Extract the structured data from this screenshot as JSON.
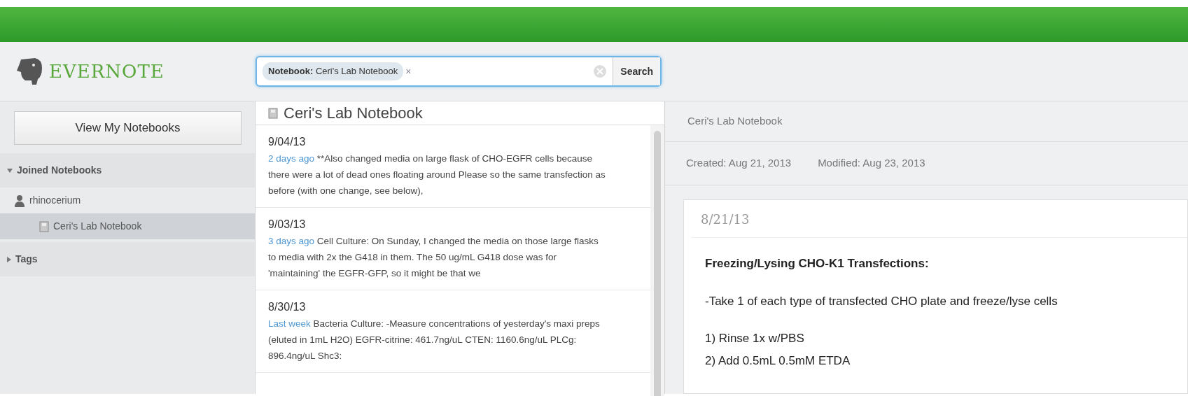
{
  "app": {
    "logo": "EVERNOTE"
  },
  "search": {
    "token_label": "Notebook:",
    "token_value": "Ceri's Lab Notebook",
    "token_remove": "×",
    "button": "Search"
  },
  "sidebar": {
    "button": "View My Notebooks",
    "sections": [
      {
        "label": "Joined Notebooks",
        "expanded": true,
        "children": [
          {
            "kind": "user",
            "label": "rhinocerium",
            "selected": false,
            "children": [
              {
                "kind": "notebook",
                "label": "Ceri's Lab Notebook",
                "selected": true
              }
            ]
          }
        ]
      },
      {
        "label": "Tags",
        "expanded": false
      }
    ]
  },
  "note_list": {
    "title": "Ceri's Lab Notebook",
    "notes": [
      {
        "date": "9/04/13",
        "age": "2 days ago",
        "snippet": "**Also changed media on large flask of CHO-EGFR cells because there were a lot of dead ones floating around  Please so the same transfection as before (with one change, see below),"
      },
      {
        "date": "9/03/13",
        "age": "3 days ago",
        "snippet": "Cell Culture: On Sunday, I changed the media on those large flasks to media with 2x the G418 in them. The 50 ug/mL G418 dose was for 'maintaining' the EGFR-GFP, so it might be that we"
      },
      {
        "date": "8/30/13",
        "age": "Last week",
        "snippet": "Bacteria Culture: -Measure concentrations of yesterday's maxi preps (eluted in 1mL H2O) EGFR-citrine: 461.7ng/uL CTEN: 1160.6ng/uL PLCg: 896.4ng/uL Shc3:"
      }
    ]
  },
  "note": {
    "notebook": "Ceri's Lab Notebook",
    "created": "Created: Aug 21, 2013",
    "modified": "Modified: Aug 23, 2013",
    "title": "8/21/13",
    "body": [
      {
        "kind": "heading",
        "text": "Freezing/Lysing CHO-K1 Transfections:"
      },
      {
        "kind": "paragraph",
        "text": "-Take 1 of each type of transfected CHO plate and freeze/lyse cells"
      },
      {
        "kind": "step",
        "text": "1) Rinse 1x w/PBS"
      },
      {
        "kind": "step",
        "text": "2) Add 0.5mL 0.5mM ETDA"
      }
    ]
  }
}
